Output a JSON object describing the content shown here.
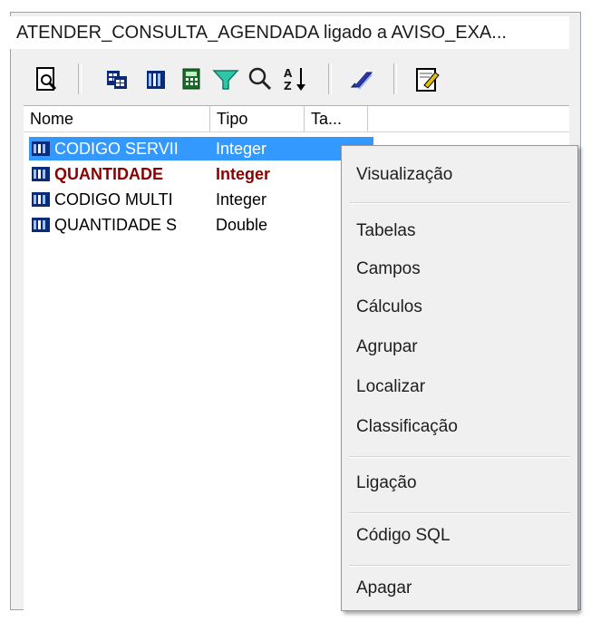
{
  "window": {
    "title": "ATENDER_CONSULTA_AGENDADA ligado a AVISO_EXA..."
  },
  "toolbar": {
    "buttons": [
      {
        "name": "preview-icon"
      },
      {
        "name": "tables-icon"
      },
      {
        "name": "fields-icon"
      },
      {
        "name": "calculator-icon"
      },
      {
        "name": "filter-icon"
      },
      {
        "name": "search-icon"
      },
      {
        "name": "sort-az-icon"
      },
      {
        "name": "link-icon"
      },
      {
        "name": "sql-edit-icon"
      }
    ]
  },
  "list": {
    "columns": [
      "Nome",
      "Tipo",
      "Ta..."
    ],
    "rows": [
      {
        "name": "CODIGO SERVII",
        "type": "Integer",
        "selected": true,
        "bold": false
      },
      {
        "name": "QUANTIDADE",
        "type": "Integer",
        "selected": false,
        "bold": true
      },
      {
        "name": "CODIGO MULTI",
        "type": "Integer",
        "selected": false,
        "bold": false
      },
      {
        "name": "QUANTIDADE S",
        "type": "Double",
        "selected": false,
        "bold": false
      }
    ]
  },
  "context_menu": {
    "items": [
      "Visualização",
      "Tabelas",
      "Campos",
      "Cálculos",
      "Agrupar",
      "Localizar",
      "Classificação",
      "Ligação",
      "Código SQL",
      "Apagar"
    ]
  },
  "colors": {
    "selection": "#3399ff",
    "bold_text": "#8b0000",
    "panel": "#f0f0f0"
  }
}
